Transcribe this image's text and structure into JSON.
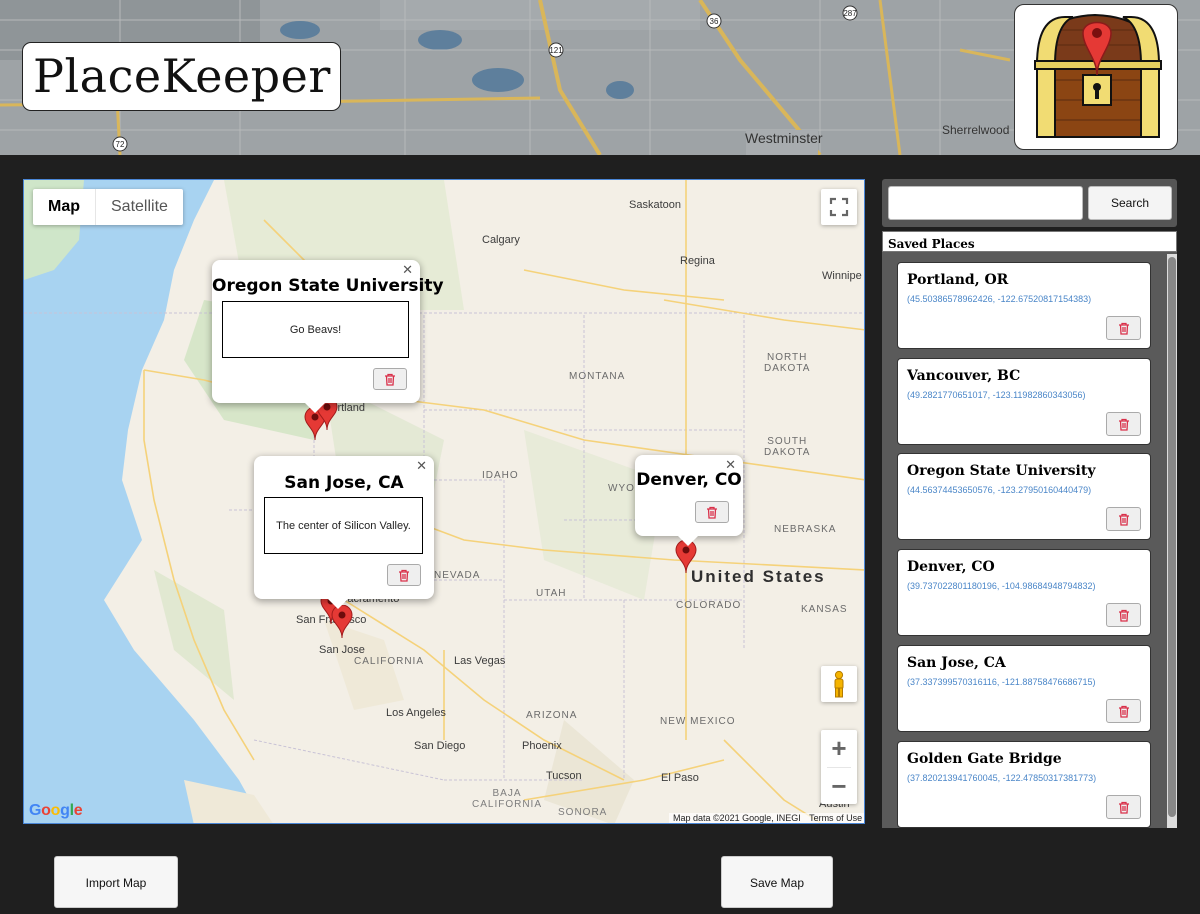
{
  "app": {
    "title": "PlaceKeeper"
  },
  "header_map_labels": {
    "westminster": "Westminster",
    "sherrelwood": "Sherrelwood",
    "road_36": "36",
    "road_287": "287",
    "road_121": "121",
    "road_72": "72"
  },
  "map": {
    "type_control": {
      "map_label": "Map",
      "satellite_label": "Satellite",
      "selected": "Map"
    },
    "labels": {
      "saskatoon": "Saskatoon",
      "calgary": "Calgary",
      "regina": "Regina",
      "winnipeg": "Winnipe",
      "north_dakota": "NORTH\nDAKOTA",
      "montana": "MONTANA",
      "south_dakota": "SOUTH\nDAKOTA",
      "idaho": "IDAHO",
      "wyoming": "WYO",
      "nebraska": "NEBRASKA",
      "nevada": "NEVADA",
      "utah": "UTAH",
      "colorado": "COLORADO",
      "kansas": "KANSAS",
      "united_states": "United States",
      "sacramento": "Sacramento",
      "san_francisco": "San Francisco",
      "san_jose": "San Jose",
      "california": "CALIFORNIA",
      "las_vegas": "Las Vegas",
      "los_angeles": "Los Angeles",
      "arizona": "ARIZONA",
      "new_mexico": "NEW MEXICO",
      "san_diego": "San Diego",
      "phoenix": "Phoenix",
      "tucson": "Tucson",
      "el_paso": "El Paso",
      "baja_california": "BAJA\nCALIFORNIA",
      "sonora": "SONORA",
      "portland": "Portland",
      "austin": "Austin"
    },
    "google_logo": "Google",
    "attribution": "Map data ©2021 Google, INEGI",
    "terms": "Terms of Use",
    "zoom_in": "+",
    "zoom_out": "−",
    "info_windows": [
      {
        "id": "osu",
        "title": "Oregon State University",
        "note": "Go Beavs!"
      },
      {
        "id": "sj",
        "title": "San Jose, CA",
        "note": "The center of Silicon Valley."
      },
      {
        "id": "den",
        "title": "Denver, CO",
        "note": ""
      }
    ],
    "marker_color": "#e53935"
  },
  "search": {
    "placeholder": "",
    "value": "",
    "button_label": "Search"
  },
  "saved_places": {
    "header": "Saved Places",
    "items": [
      {
        "name": "Portland, OR",
        "coords": "(45.50386578962426, -122.67520817154383)"
      },
      {
        "name": "Vancouver, BC",
        "coords": "(49.2821770651017, -123.11982860343056)"
      },
      {
        "name": "Oregon State University",
        "coords": "(44.56374453650576, -123.27950160440479)"
      },
      {
        "name": "Denver, CO",
        "coords": "(39.737022801180196, -104.98684948794832)"
      },
      {
        "name": "San Jose, CA",
        "coords": "(37.337399570316116, -121.88758476686715)"
      },
      {
        "name": "Golden Gate Bridge",
        "coords": "(37.820213941760045, -122.47850317381773)"
      }
    ]
  },
  "actions": {
    "import_label": "Import Map",
    "save_label": "Save Map"
  },
  "colors": {
    "page_bg": "#1f1f1f",
    "link_blue": "#4a86c8",
    "trash_red": "#d9304a"
  }
}
